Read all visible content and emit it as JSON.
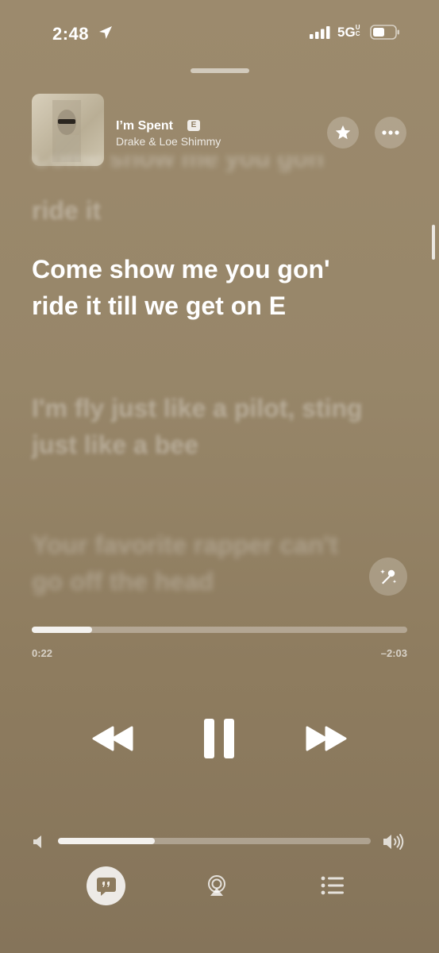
{
  "status_bar": {
    "time": "2:48",
    "network": "5G",
    "network_suffix": "UC"
  },
  "player": {
    "title": "I’m Spent",
    "explicit_badge": "E",
    "artist": "Drake & Loe Shimmy"
  },
  "lyrics": {
    "previous_fragment": "Come show me you gon'",
    "previous": "ride it",
    "current": "Come show me you gon' ride it till we get on E",
    "next": "I'm fly just like a pilot, sting just like a bee",
    "next2": "Your favorite rapper can't go off the head"
  },
  "progress": {
    "elapsed": "0:22",
    "remaining": "–2:03",
    "fraction": 0.16
  },
  "volume": {
    "fraction": 0.31
  },
  "icons": {
    "location": "location-arrow-icon",
    "signal": "cellular-signal-icon",
    "battery": "battery-icon",
    "favorite": "star-icon",
    "more": "ellipsis-icon",
    "sing": "microphone-sparkle-icon",
    "rewind": "rewind-icon",
    "pause": "pause-icon",
    "forward": "fast-forward-icon",
    "volume_low": "speaker-low-icon",
    "volume_high": "speaker-high-icon",
    "lyrics": "quote-bubble-icon",
    "airplay": "airplay-audio-icon",
    "queue": "list-icon"
  }
}
